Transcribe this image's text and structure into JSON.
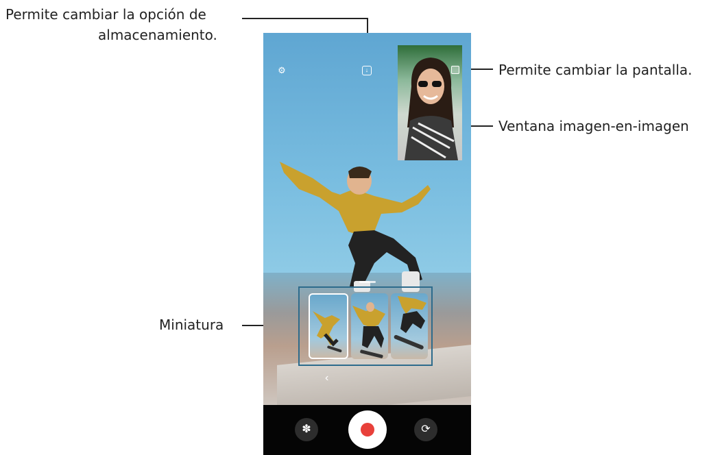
{
  "callouts": {
    "storage_line1": "Permite cambiar la opción de",
    "storage_line2": "almacenamiento.",
    "screen_switch": "Permite cambiar la pantalla.",
    "pip_window": "Ventana imagen-en-imagen",
    "thumbnail": "Miniatura"
  },
  "icons": {
    "settings": "gear-icon",
    "storage": "download-icon",
    "switch_screen": "switch-screen-icon",
    "back": "chevron-left-icon",
    "filter": "filter-icon",
    "shutter": "record-icon",
    "flip_camera": "flip-camera-icon"
  },
  "glyphs": {
    "settings": "⚙",
    "storage": "↓",
    "back": "‹",
    "filter": "✽",
    "flip": "⟳"
  },
  "colors": {
    "record": "#e8403a",
    "callout_line": "#222222",
    "highlight": "#2d6b8c"
  }
}
